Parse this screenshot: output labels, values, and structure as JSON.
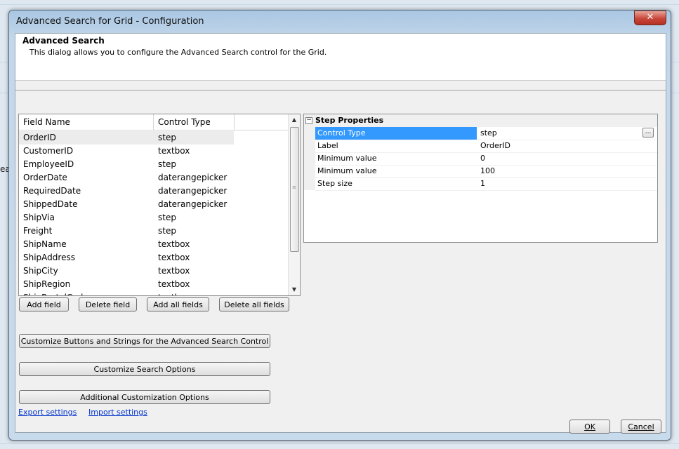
{
  "window": {
    "title": "Advanced Search for Grid - Configuration",
    "close_glyph": "✕"
  },
  "background": {
    "peek_text": "ea"
  },
  "header": {
    "title": "Advanced Search",
    "description": "This dialog allows you to configure the Advanced Search control for the Grid."
  },
  "fields_grid": {
    "columns": [
      "Field Name",
      "Control Type"
    ],
    "rows": [
      {
        "field": "OrderID",
        "control": "step"
      },
      {
        "field": "CustomerID",
        "control": "textbox"
      },
      {
        "field": "EmployeeID",
        "control": "step"
      },
      {
        "field": "OrderDate",
        "control": "daterangepicker"
      },
      {
        "field": "RequiredDate",
        "control": "daterangepicker"
      },
      {
        "field": "ShippedDate",
        "control": "daterangepicker"
      },
      {
        "field": "ShipVia",
        "control": "step"
      },
      {
        "field": "Freight",
        "control": "step"
      },
      {
        "field": "ShipName",
        "control": "textbox"
      },
      {
        "field": "ShipAddress",
        "control": "textbox"
      },
      {
        "field": "ShipCity",
        "control": "textbox"
      },
      {
        "field": "ShipRegion",
        "control": "textbox"
      },
      {
        "field": "ShipPostalCode",
        "control": "textbox"
      }
    ],
    "selected_index": 0
  },
  "field_buttons": {
    "add": "Add field",
    "delete": "Delete field",
    "add_all": "Add all fields",
    "delete_all": "Delete all fields"
  },
  "properties": {
    "category": "Step Properties",
    "toggle": "−",
    "ellipsis": "...",
    "rows": [
      {
        "key": "Control Type",
        "value": "step"
      },
      {
        "key": "Label",
        "value": "OrderID"
      },
      {
        "key": "Minimum value",
        "value": "0"
      },
      {
        "key": "Minimum value",
        "value": "100"
      },
      {
        "key": "Step size",
        "value": "1"
      }
    ],
    "selected_index": 0
  },
  "custom_buttons": {
    "buttons_strings": "Customize Buttons and Strings for the Advanced Search Control",
    "search_options": "Customize Search Options",
    "additional": "Additional Customization Options"
  },
  "links": {
    "export": "Export settings",
    "import": "Import settings"
  },
  "dialog_buttons": {
    "ok": "OK",
    "cancel": "Cancel"
  },
  "colors": {
    "selection": "#3399ff",
    "link": "#0033cc",
    "close_button": "#c8473a"
  }
}
